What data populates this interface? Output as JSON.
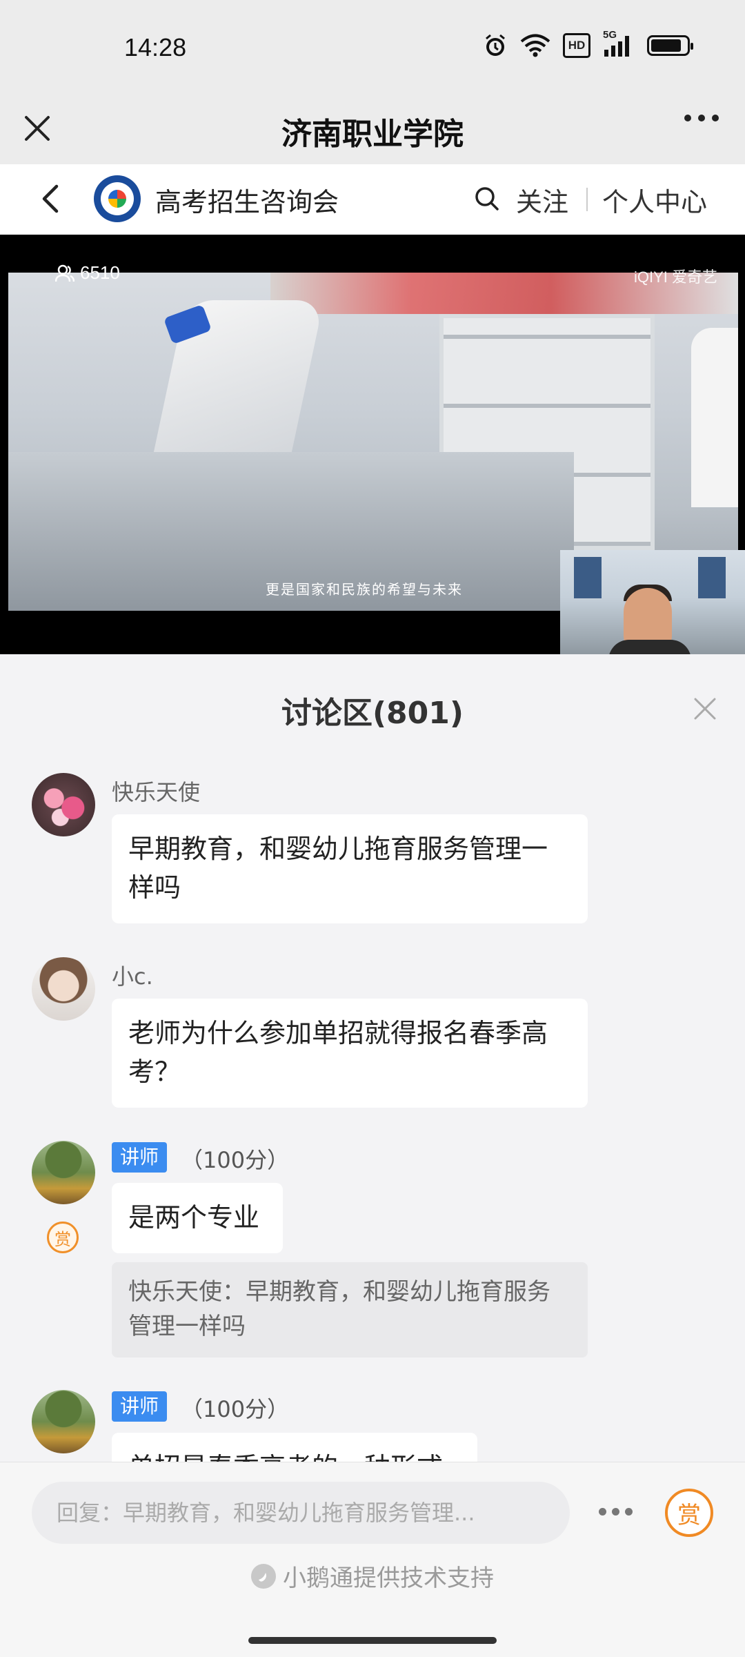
{
  "status": {
    "time": "14:28",
    "hd_label": "HD",
    "signal_label": "5G",
    "battery_level_percent": 88
  },
  "nav": {
    "title": "济南职业学院"
  },
  "channel": {
    "name": "高考招生咨询会",
    "follow_label": "关注",
    "personal_center_label": "个人中心"
  },
  "video": {
    "viewer_count": "6510",
    "watermark": "iQIYI 爱奇艺",
    "subtitle": "更是国家和民族的希望与未来"
  },
  "discussion": {
    "title": "讨论区(801)",
    "messages": [
      {
        "user": "快乐天使",
        "text": "早期教育，和婴幼儿拖育服务管理一样吗"
      },
      {
        "user": "小c.",
        "text": "老师为什么参加单招就得报名春季高考？"
      },
      {
        "badge": "讲师",
        "score": "（100分）",
        "reward": "赏",
        "text": "是两个专业",
        "quote": "快乐天使：早期教育，和婴幼儿拖育服务管理一样吗"
      },
      {
        "badge": "讲师",
        "score": "（100分）",
        "text": "单招是春季高考的一种形式"
      }
    ]
  },
  "footer": {
    "reply_placeholder": "回复：早期教育，和婴幼儿拖育服务管理...",
    "reward_label": "赏",
    "support_text": "小鹅通提供技术支持"
  },
  "colors": {
    "accent_blue": "#3b8cf0",
    "reward_orange": "#f08a24"
  }
}
